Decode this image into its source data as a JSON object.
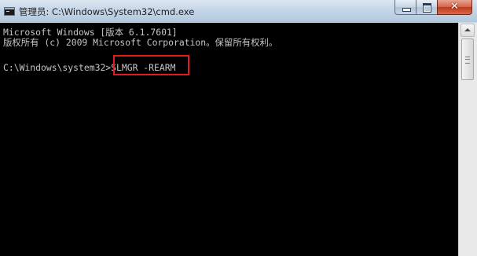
{
  "window": {
    "title": "管理员: C:\\Windows\\System32\\cmd.exe",
    "close_glyph": "✕"
  },
  "console": {
    "lines": [
      "Microsoft Windows [版本 6.1.7601]",
      "版权所有 (c) 2009 Microsoft Corporation。保留所有权利。",
      "",
      "C:\\Windows\\system32>SLMGR -REARM"
    ],
    "highlighted_command": "SLMGR -REARM"
  },
  "colors": {
    "console_bg": "#000000",
    "console_text": "#c6c6c6",
    "highlight_border": "#e21b22",
    "close_button": "#c8401f"
  },
  "icons": {
    "app": "cmd-icon",
    "minimize": "minimize-icon",
    "maximize": "maximize-icon",
    "close": "close-icon",
    "scroll_up": "scroll-up-arrow-icon"
  }
}
